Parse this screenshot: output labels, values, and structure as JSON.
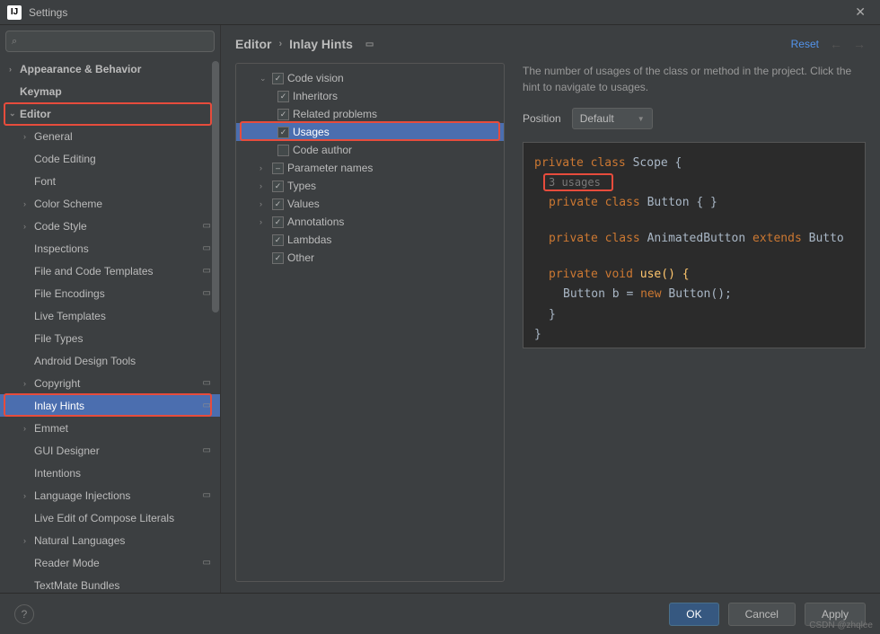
{
  "window": {
    "title": "Settings"
  },
  "search": {
    "placeholder": ""
  },
  "sidebar": {
    "items": [
      {
        "label": "Appearance & Behavior",
        "arrow": "›",
        "indent": 0,
        "bold": true
      },
      {
        "label": "Keymap",
        "arrow": "",
        "indent": 0,
        "bold": true
      },
      {
        "label": "Editor",
        "arrow": "⌄",
        "indent": 0,
        "bold": true
      },
      {
        "label": "General",
        "arrow": "›",
        "indent": 1
      },
      {
        "label": "Code Editing",
        "arrow": "",
        "indent": 1
      },
      {
        "label": "Font",
        "arrow": "",
        "indent": 1
      },
      {
        "label": "Color Scheme",
        "arrow": "›",
        "indent": 1
      },
      {
        "label": "Code Style",
        "arrow": "›",
        "indent": 1,
        "sq": true
      },
      {
        "label": "Inspections",
        "arrow": "",
        "indent": 1,
        "sq": true
      },
      {
        "label": "File and Code Templates",
        "arrow": "",
        "indent": 1,
        "sq": true
      },
      {
        "label": "File Encodings",
        "arrow": "",
        "indent": 1,
        "sq": true
      },
      {
        "label": "Live Templates",
        "arrow": "",
        "indent": 1
      },
      {
        "label": "File Types",
        "arrow": "",
        "indent": 1
      },
      {
        "label": "Android Design Tools",
        "arrow": "",
        "indent": 1
      },
      {
        "label": "Copyright",
        "arrow": "›",
        "indent": 1,
        "sq": true
      },
      {
        "label": "Inlay Hints",
        "arrow": "",
        "indent": 1,
        "sq": true,
        "selected": true
      },
      {
        "label": "Emmet",
        "arrow": "›",
        "indent": 1
      },
      {
        "label": "GUI Designer",
        "arrow": "",
        "indent": 1,
        "sq": true
      },
      {
        "label": "Intentions",
        "arrow": "",
        "indent": 1
      },
      {
        "label": "Language Injections",
        "arrow": "›",
        "indent": 1,
        "sq": true
      },
      {
        "label": "Live Edit of Compose Literals",
        "arrow": "",
        "indent": 1
      },
      {
        "label": "Natural Languages",
        "arrow": "›",
        "indent": 1
      },
      {
        "label": "Reader Mode",
        "arrow": "",
        "indent": 1,
        "sq": true
      },
      {
        "label": "TextMate Bundles",
        "arrow": "",
        "indent": 1
      }
    ]
  },
  "breadcrumb": {
    "part1": "Editor",
    "part2": "Inlay Hints",
    "reset": "Reset"
  },
  "middle": {
    "items": [
      {
        "label": "Code vision",
        "arrow": "⌄",
        "checked": true,
        "indent": 0
      },
      {
        "label": "Inheritors",
        "arrow": "",
        "checked": true,
        "indent": 1
      },
      {
        "label": "Related problems",
        "arrow": "",
        "checked": true,
        "indent": 1
      },
      {
        "label": "Usages",
        "arrow": "",
        "checked": true,
        "indent": 1,
        "selected": true
      },
      {
        "label": "Code author",
        "arrow": "",
        "checked": false,
        "indent": 1
      },
      {
        "label": "Parameter names",
        "arrow": "›",
        "checked": null,
        "indent": 0,
        "dash": true
      },
      {
        "label": "Types",
        "arrow": "›",
        "checked": true,
        "indent": 0
      },
      {
        "label": "Values",
        "arrow": "›",
        "checked": true,
        "indent": 0
      },
      {
        "label": "Annotations",
        "arrow": "›",
        "checked": true,
        "indent": 0
      },
      {
        "label": "Lambdas",
        "arrow": "",
        "checked": true,
        "indent": 0
      },
      {
        "label": "Other",
        "arrow": "",
        "checked": true,
        "indent": 0
      }
    ]
  },
  "rightpanel": {
    "desc": "The number of usages of the class or method in the project. Click the hint to navigate to usages.",
    "posLabel": "Position",
    "posValue": "Default",
    "code": {
      "l1a": "private",
      "l1b": "class",
      "l1c": "Scope {",
      "hint": "3 usages",
      "l2a": "private",
      "l2b": "class",
      "l2c": "Button { }",
      "l3a": "private",
      "l3b": "class",
      "l3c": "AnimatedButton",
      "l3d": "extends",
      "l3e": "Butto",
      "l4a": "private",
      "l4b": "void",
      "l4c": "use() {",
      "l5a": "Button b =",
      "l5b": "new",
      "l5c": "Button();",
      "l6": "}",
      "l7": "}"
    }
  },
  "footer": {
    "ok": "OK",
    "cancel": "Cancel",
    "apply": "Apply"
  },
  "watermark": "CSDN @zhqlee"
}
